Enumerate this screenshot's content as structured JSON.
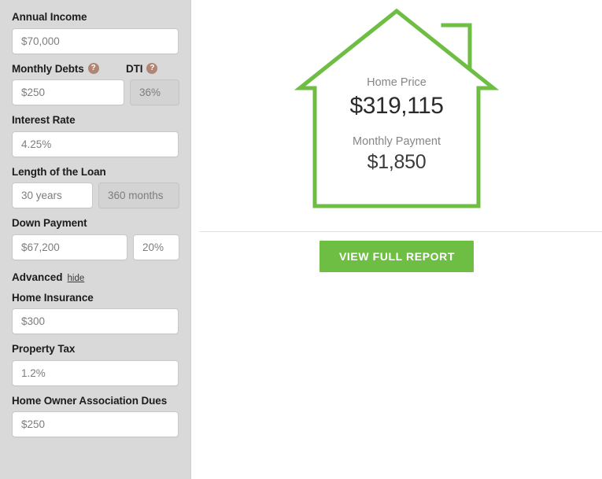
{
  "accent": {
    "green": "#6fbe44",
    "house_outline": "#6fbe44",
    "help_icon": "#b08573",
    "sidebar_bg": "#d9d9d9"
  },
  "sidebar": {
    "fields": [
      {
        "id": "annual-income",
        "label": "Annual Income",
        "value": "$70,000",
        "placeholder": "$70,000",
        "help": null
      },
      {
        "id": "monthly-debts",
        "label": "Monthly Debts",
        "value": "$250",
        "placeholder": "$250",
        "help": "?"
      },
      {
        "id": "dti",
        "label": "DTI",
        "value": "36%",
        "placeholder": "36%",
        "help": "?",
        "readonly": true
      },
      {
        "id": "interest-rate",
        "label": "Interest Rate",
        "value": "4.25%",
        "placeholder": "4.25%",
        "help": null
      },
      {
        "id": "loan-length-years",
        "label": "Length of the Loan",
        "value": "30 years",
        "placeholder": "30 years",
        "help": null
      },
      {
        "id": "loan-length-months",
        "label": "",
        "value": "360 months",
        "placeholder": "360 months",
        "readonly": true
      },
      {
        "id": "down-payment",
        "label": "Down Payment",
        "value": "$67,200",
        "placeholder": "$67,200",
        "help": null
      },
      {
        "id": "down-payment-percent",
        "label": "",
        "value": "20%",
        "placeholder": "20%"
      },
      {
        "id": "home-insurance",
        "label": "Home Insurance",
        "value": "$300",
        "placeholder": "$300",
        "help": null
      },
      {
        "id": "property-tax",
        "label": "Property Tax",
        "value": "1.2%",
        "placeholder": "1.2%",
        "help": null
      },
      {
        "id": "hoa-dues",
        "label": "Home Owner Association Dues",
        "value": "$250",
        "placeholder": "$250",
        "help": null
      }
    ],
    "advanced": {
      "title": "Advanced",
      "toggle_label": "hide"
    },
    "help_glyph": "?"
  },
  "results": {
    "home_price_label": "Home Price",
    "home_price_value": "$319,115",
    "monthly_payment_label": "Monthly Payment",
    "monthly_payment_value": "$1,850"
  },
  "cta": {
    "view_full_report_label": "VIEW FULL REPORT"
  }
}
